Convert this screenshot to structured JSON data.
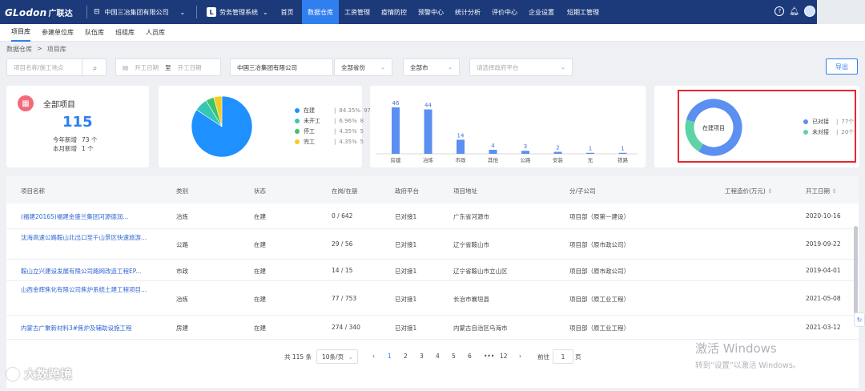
{
  "topbar": {
    "logo": "GLodon",
    "logo_cn": "广联达",
    "company": "中国三冶集团有限公司",
    "system": "劳务管理系统",
    "nav": [
      {
        "label": "首页",
        "active": false
      },
      {
        "label": "数据仓库",
        "active": true
      },
      {
        "label": "工资管理",
        "active": false
      },
      {
        "label": "疫情防控",
        "active": false
      },
      {
        "label": "预警中心",
        "active": false
      },
      {
        "label": "统计分析",
        "active": false
      },
      {
        "label": "评价中心",
        "active": false
      },
      {
        "label": "企业设置",
        "active": false
      },
      {
        "label": "短期工管理",
        "active": false
      }
    ]
  },
  "subnav": [
    {
      "label": "项目库",
      "active": true
    },
    {
      "label": "参建单位库",
      "active": false
    },
    {
      "label": "队伍库",
      "active": false
    },
    {
      "label": "班组库",
      "active": false
    },
    {
      "label": "人员库",
      "active": false
    }
  ],
  "breadcrumb": {
    "root": "数据仓库",
    "sep": ">",
    "current": "项目库"
  },
  "filters": {
    "search_placeholder": "项目名称/施工地点",
    "start_placeholder": "开工日期",
    "to": "至",
    "end_placeholder": "开工日期",
    "company": "中国三冶集团有限公司",
    "province": "全部省份",
    "city": "全部市",
    "platform_placeholder": "请选择政府平台",
    "export": "导出"
  },
  "summary": {
    "title": "全部项目",
    "total": "115",
    "year_label": "今年新增",
    "year_value": "73 个",
    "month_label": "本月新增",
    "month_value": "1 个"
  },
  "colors": {
    "primary": "#2f7ff0",
    "blue": "#1e90ff",
    "teal": "#36c6b6",
    "green": "#3cc46a",
    "yellow": "#f4cb21",
    "highlight": "#e8262f"
  },
  "chart_data": [
    {
      "type": "pie",
      "labels": [
        "在建",
        "未开工",
        "停工",
        "完工"
      ],
      "values": [
        97,
        8,
        5,
        5
      ],
      "percents": [
        "84.35%",
        "6.96%",
        "4.35%",
        "4.35%"
      ],
      "colors": [
        "#1e90ff",
        "#36c6b6",
        "#3cc46a",
        "#f4cb21"
      ]
    },
    {
      "type": "bar",
      "categories": [
        "房建",
        "冶炼",
        "市政",
        "其他",
        "公路",
        "安装",
        "无",
        "铁路"
      ],
      "values": [
        46,
        44,
        14,
        4,
        3,
        2,
        1,
        1
      ],
      "ylim": [
        0,
        50
      ],
      "color": "#5b8ff0"
    },
    {
      "type": "pie",
      "center_label": "在建项目",
      "labels": [
        "已对接",
        "未对接"
      ],
      "values": [
        77,
        20
      ],
      "value_labels": [
        "77个",
        "20个"
      ],
      "colors": [
        "#5b8ff0",
        "#5fd3a6"
      ]
    }
  ],
  "table": {
    "headers": [
      "项目名称",
      "类别",
      "状态",
      "在岗/在册",
      "政府平台",
      "项目地址",
      "分/子公司",
      "工程造价(万元)",
      "开工日期"
    ],
    "rows": [
      {
        "name": "(福建20165)福建金盛兰集团河源德润...",
        "cat": "冶炼",
        "status": "在建",
        "count": "0 / 642",
        "platform": "已对接1",
        "addr": "广东省河源市",
        "sub": "项目部（原第一建设）",
        "cost": "",
        "date": "2020-10-16"
      },
      {
        "name": "沈海高速公路鞍山北出口至千山景区快速旅游...",
        "cat": "公路",
        "status": "在建",
        "count": "29 / 56",
        "platform": "已对接1",
        "addr": "辽宁省鞍山市",
        "sub": "项目部（原市政公司）",
        "cost": "",
        "date": "2019-09-22"
      },
      {
        "name": "鞍山立兴建设发展有限公司路网改造工程EP...",
        "cat": "市政",
        "status": "在建",
        "count": "14 / 15",
        "platform": "已对接1",
        "addr": "辽宁省鞍山市立山区",
        "sub": "项目部（原市政公司）",
        "cost": "",
        "date": "2019-04-01"
      },
      {
        "name": "山西金辉焦化有限公司焦炉系统土建工程项目...",
        "cat": "冶炼",
        "status": "在建",
        "count": "77 / 753",
        "platform": "已对接1",
        "addr": "长治市襄垣县",
        "sub": "项目部（原工业工程）",
        "cost": "",
        "date": "2021-05-08"
      },
      {
        "name": "内蒙古广聚新材料3#焦炉及辅助设施工程",
        "cat": "房建",
        "status": "在建",
        "count": "274 / 340",
        "platform": "已对接1",
        "addr": "内蒙古自治区乌海市",
        "sub": "项目部（原工业工程）",
        "cost": "",
        "date": "2021-03-12"
      }
    ]
  },
  "pagination": {
    "total_text": "共 115 条",
    "page_size": "10条/页",
    "prev": "‹",
    "pages": [
      "1",
      "2",
      "3",
      "4",
      "5",
      "6",
      "•••",
      "12"
    ],
    "next": "›",
    "goto_label": "前往",
    "goto_value": "1",
    "page_unit": "页"
  },
  "watermark": {
    "line1": "激活 Windows",
    "line2": "转到“设置”以激活 Windows。"
  },
  "brand": "大数跨境"
}
